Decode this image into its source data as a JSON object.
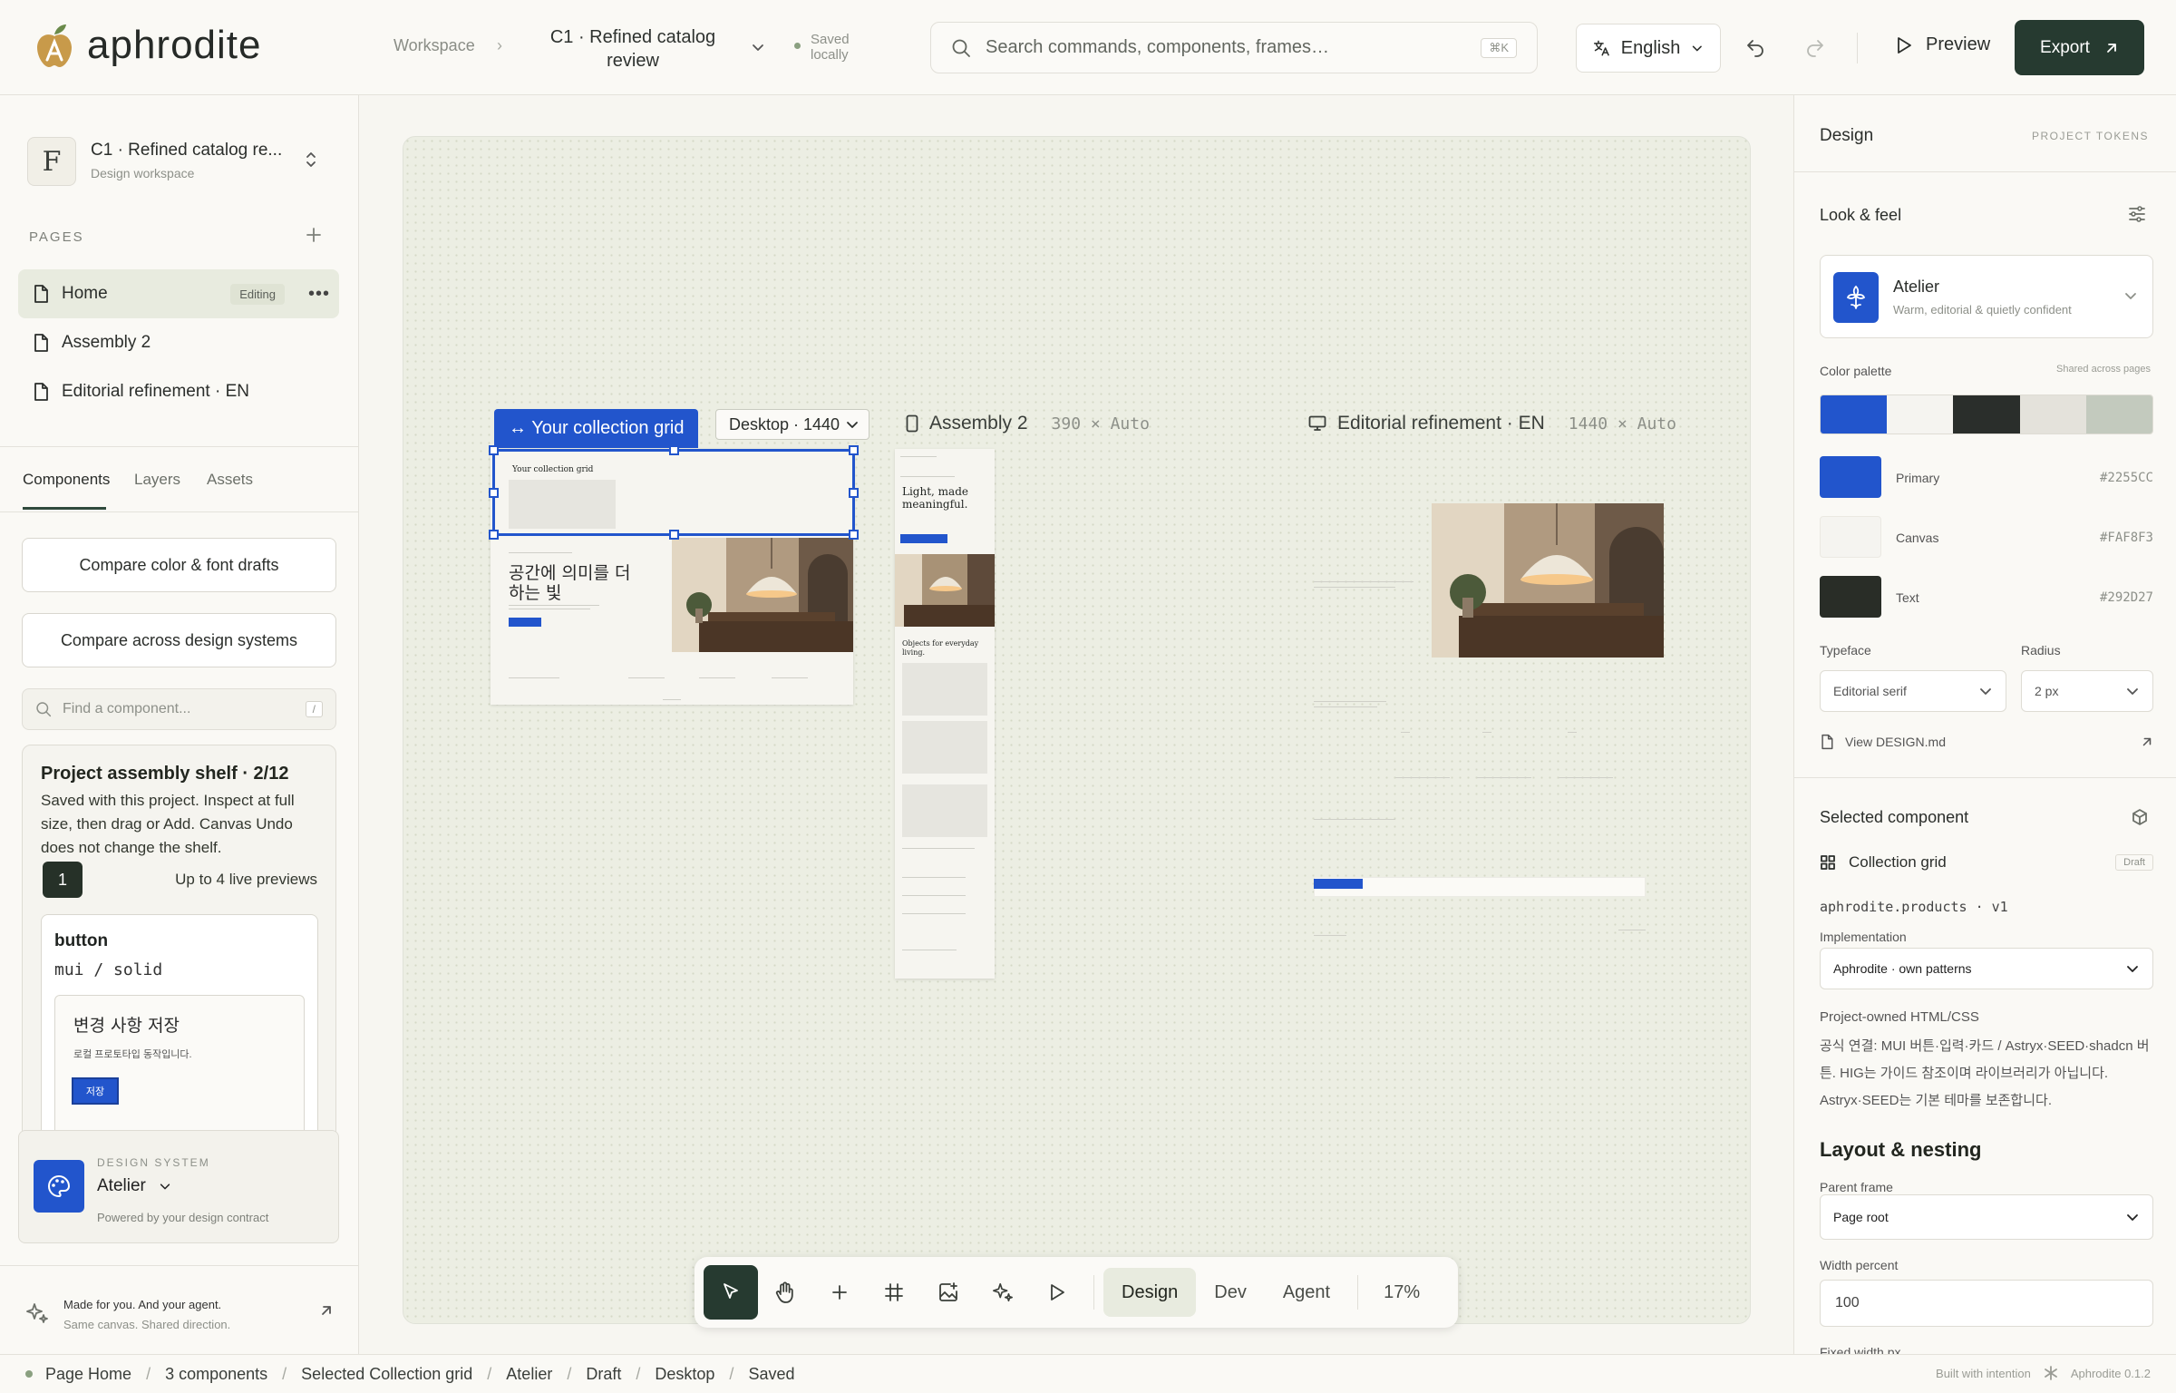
{
  "app": {
    "name": "aphrodite",
    "version": "Aphrodite 0.1.2",
    "built": "Built with intention"
  },
  "header": {
    "workspace": "Workspace",
    "project_title": "C1 · Refined catalog review",
    "saved_line1": "Saved",
    "saved_line2": "locally",
    "search_placeholder": "Search commands, components, frames…",
    "search_shortcut": "⌘K",
    "language": "English",
    "preview_label": "Preview",
    "export_label": "Export"
  },
  "sidebar": {
    "workspace_avatar": "F",
    "workspace_name": "C1 · Refined catalog re...",
    "workspace_sub": "Design workspace",
    "pages_heading": "PAGES",
    "pages": [
      {
        "label": "Home",
        "badge": "Editing"
      },
      {
        "label": "Assembly 2"
      },
      {
        "label": "Editorial refinement · EN"
      }
    ],
    "tabs": [
      "Components",
      "Layers",
      "Assets"
    ],
    "compare_color": "Compare color & font drafts",
    "compare_systems": "Compare across design systems",
    "find_placeholder": "Find a component...",
    "find_shortcut": "/",
    "shelf": {
      "title": "Project assembly shelf · 2/12",
      "description": "Saved with this project. Inspect at full size, then drag or Add. Canvas Undo does not change the shelf.",
      "count": "1",
      "limit": "Up to 4 live previews",
      "component_name": "button",
      "component_variant": "mui / solid",
      "preview_title": "변경 사항 저장",
      "preview_sub": "로컬 프로토타입 동작입니다.",
      "preview_button": "저장"
    },
    "design_system": {
      "label": "DESIGN SYSTEM",
      "name": "Atelier",
      "sub": "Powered by your design contract"
    },
    "made_for": "Made for you. And your agent.",
    "made_sub": "Same canvas. Shared direction."
  },
  "canvas": {
    "selected_tag": "↔ Your collection grid",
    "breakpoint": "Desktop · 1440",
    "frame2_label": "Assembly 2",
    "frame2_size": "390 × Auto",
    "frame3_label": "Editorial refinement · EN",
    "frame3_size": "1440 × Auto",
    "frame1_title": "Your collection grid",
    "frame1_korean": "공간에 의미를 더하는 빛",
    "frame2_headline": "Light, made meaningful.",
    "frame2_objects": "Objects for everyday living."
  },
  "dock": {
    "modes": [
      "Design",
      "Dev",
      "Agent"
    ],
    "zoom": "17%"
  },
  "right": {
    "title": "Design",
    "tokens_link": "PROJECT TOKENS",
    "look_feel": "Look & feel",
    "theme_name": "Atelier",
    "theme_sub": "Warm, editorial & quietly confident",
    "palette_label": "Color palette",
    "palette_shared": "Shared across pages",
    "palette": [
      "#2255CC",
      "#F5F4F0",
      "#2A2E2B",
      "#E4E2DB",
      "#C3CABE"
    ],
    "swatches": [
      {
        "name": "Primary",
        "hex": "#2255CC",
        "color": "#2255CC"
      },
      {
        "name": "Canvas",
        "hex": "#FAF8F3",
        "color": "#F5F4F0"
      },
      {
        "name": "Text",
        "hex": "#292D27",
        "color": "#292D27"
      }
    ],
    "typeface_label": "Typeface",
    "typeface": "Editorial serif",
    "radius_label": "Radius",
    "radius": "2 px",
    "view_design_md": "View DESIGN.md",
    "selected_component": "Selected component",
    "component_name": "Collection grid",
    "component_status": "Draft",
    "component_path": "aphrodite.products · v1",
    "implementation_label": "Implementation",
    "implementation": "Aphrodite · own patterns",
    "project_owned": "Project-owned HTML/CSS",
    "korean_note": "공식 연결: MUI 버튼·입력·카드 / Astryx·SEED·shadcn 버튼. HIG는 가이드 참조이며 라이브러리가 아닙니다. Astryx·SEED는 기본 테마를 보존합니다.",
    "layout_heading": "Layout & nesting",
    "parent_frame_label": "Parent frame",
    "parent_frame": "Page root",
    "width_percent_label": "Width percent",
    "width_percent": "100",
    "fixed_width_label": "Fixed width px"
  },
  "status": {
    "items": [
      "Page Home",
      "3 components",
      "Selected Collection grid",
      "Atelier",
      "Draft",
      "Desktop",
      "Saved"
    ]
  }
}
